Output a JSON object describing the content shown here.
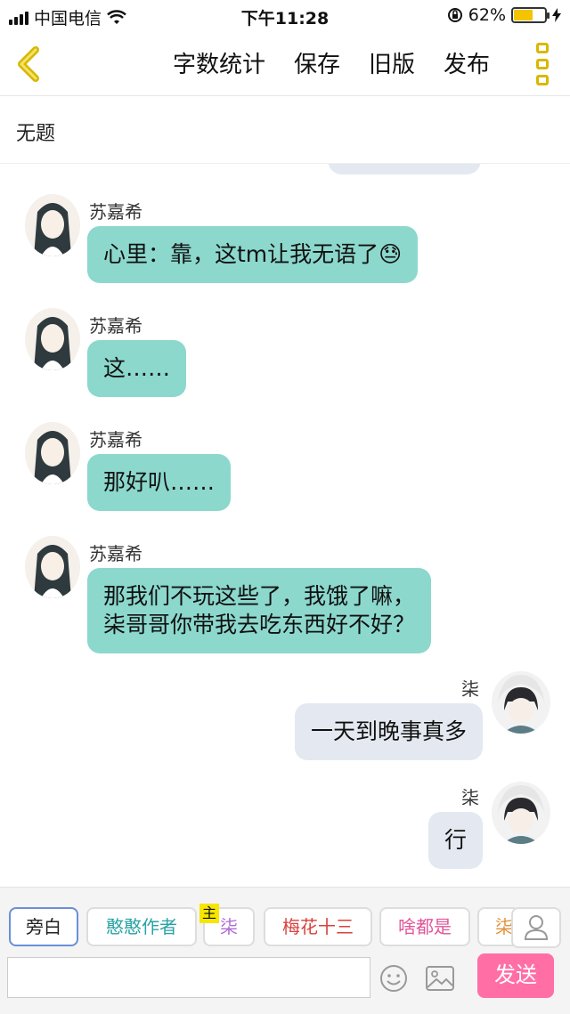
{
  "status": {
    "carrier": "中国电信",
    "time": "下午11:28",
    "battery_text": "62%",
    "battery_level": 0.62
  },
  "nav": {
    "actions": [
      "字数统计",
      "保存",
      "旧版",
      "发布"
    ]
  },
  "subtitle": "无题",
  "messages": [
    {
      "side": "left",
      "name": "苏嘉希",
      "text": "心里：靠，这tm让我无语了",
      "emoji": "😓"
    },
    {
      "side": "left",
      "name": "苏嘉希",
      "text": "这……"
    },
    {
      "side": "left",
      "name": "苏嘉希",
      "text": "那好叭……"
    },
    {
      "side": "left",
      "name": "苏嘉希",
      "lines": [
        "那我们不玩这些了，我饿了嘛，",
        "柒哥哥你带我去吃东西好不好？"
      ]
    },
    {
      "side": "right",
      "name": "柒",
      "text": "一天到晚事真多"
    },
    {
      "side": "right",
      "name": "柒",
      "text": "行"
    }
  ],
  "chips": [
    {
      "label": "旁白",
      "color": "#222222"
    },
    {
      "label": "憨憨作者",
      "color": "#29a3a3"
    },
    {
      "label": "柒",
      "color": "#b06ad6"
    },
    {
      "label": "梅花十三",
      "color": "#d9413c"
    },
    {
      "label": "啥都是",
      "color": "#e2559a"
    },
    {
      "label": "柒",
      "color": "#e0923a"
    }
  ],
  "main_badge": "主",
  "input": {
    "placeholder": "",
    "value": ""
  },
  "send_label": "发送",
  "colors": {
    "left_bubble": "#8cd8cd",
    "right_bubble": "#e4e9f1",
    "send": "#ff6fa6",
    "accent": "#d8b800"
  }
}
